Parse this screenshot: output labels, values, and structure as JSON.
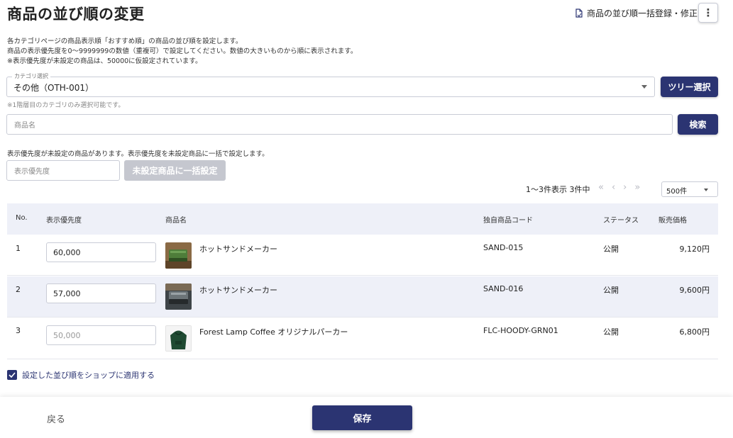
{
  "header": {
    "title": "商品の並び順の変更",
    "bulk_link_label": "商品の並び順一括登録・修正",
    "more_icon": "⋮"
  },
  "description": {
    "line1": "各カテゴリページの商品表示順「おすすめ順」の商品の並び順を設定します。",
    "line2": "商品の表示優先度を0～9999999の数値（重複可）で設定してください。数値の大きいものから順に表示されます。",
    "line3": "※表示優先度が未設定の商品は、50000に仮設定されています。"
  },
  "category": {
    "legend": "カテゴリ選択",
    "value": "その他（OTH-001）",
    "tree_button": "ツリー選択",
    "note": "※1階層目のカテゴリのみ選択可能です。"
  },
  "search": {
    "placeholder": "商品名",
    "button": "検索"
  },
  "unset": {
    "note": "表示優先度が未設定の商品があります。表示優先度を未設定商品に一括で設定します。",
    "placeholder": "表示優先度",
    "button": "未設定商品に一括設定"
  },
  "pager": {
    "summary": "1～3件表示 3件中",
    "first": "«",
    "prev": "‹",
    "next": "›",
    "last": "»",
    "per_page": "500件"
  },
  "table": {
    "headers": {
      "no": "No.",
      "priority": "表示優先度",
      "name": "商品名",
      "code": "独自商品コード",
      "status": "ステータス",
      "price": "販売価格"
    },
    "rows": [
      {
        "no": "1",
        "priority": "60,000",
        "name": "ホットサンドメーカー",
        "code": "SAND-015",
        "status": "公開",
        "price": "9,120円"
      },
      {
        "no": "2",
        "priority": "57,000",
        "name": "ホットサンドメーカー",
        "code": "SAND-016",
        "status": "公開",
        "price": "9,600円"
      },
      {
        "no": "3",
        "priority_placeholder": "50,000",
        "name": "Forest Lamp Coffee オリジナルパーカー",
        "code": "FLC-HOODY-GRN01",
        "status": "公開",
        "price": "6,800円"
      }
    ]
  },
  "apply": {
    "label": "設定した並び順をショップに適用する",
    "checked": true
  },
  "footer": {
    "back": "戻る",
    "save": "保存"
  },
  "colors": {
    "primary": "#2b3472",
    "header_bg": "#eef0f8",
    "disabled": "#c5c7cf"
  }
}
